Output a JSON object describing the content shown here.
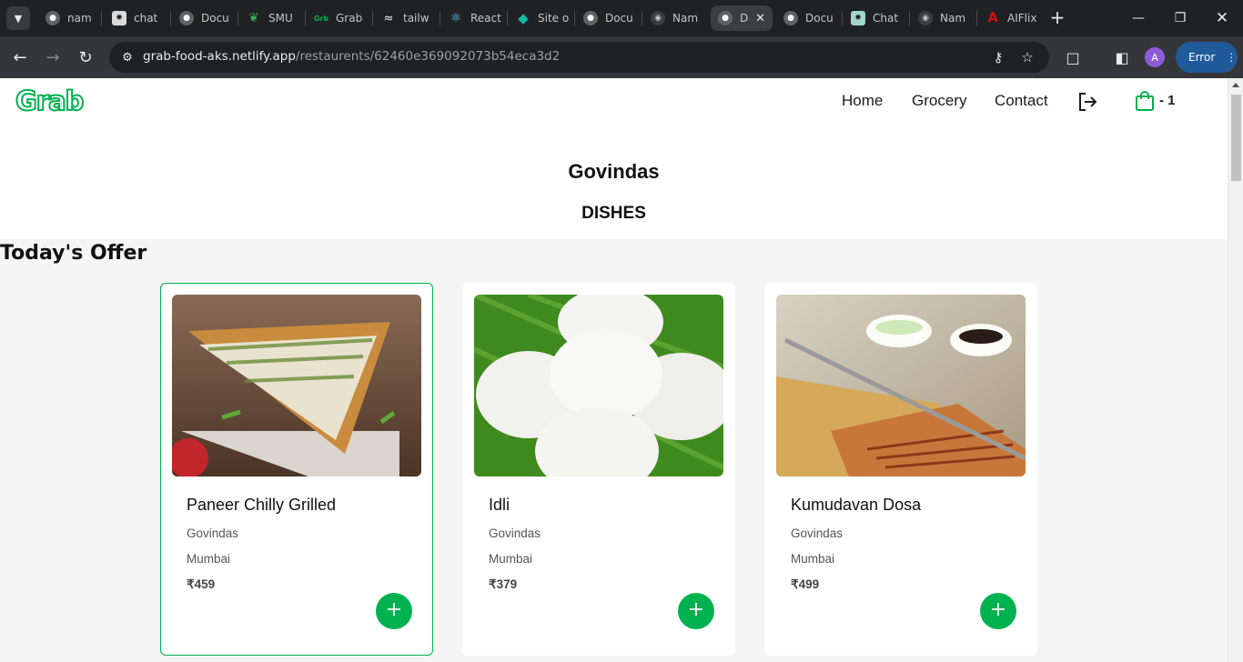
{
  "browser": {
    "tabs": [
      {
        "title": "nam",
        "icon": "generic-globe-icon"
      },
      {
        "title": "chat",
        "icon": "openai-icon"
      },
      {
        "title": "Docu",
        "icon": "generic-globe-icon"
      },
      {
        "title": "SMU",
        "icon": "leaf-icon"
      },
      {
        "title": "Grab",
        "icon": "grab-icon"
      },
      {
        "title": "tailw",
        "icon": "tailwind-icon"
      },
      {
        "title": "React",
        "icon": "react-icon"
      },
      {
        "title": "Site o",
        "icon": "netlify-icon"
      },
      {
        "title": "Docu",
        "icon": "generic-globe-icon"
      },
      {
        "title": "Nam",
        "icon": "github-icon"
      },
      {
        "title": "D",
        "icon": "generic-globe-icon"
      },
      {
        "title": "Docu",
        "icon": "generic-globe-icon"
      },
      {
        "title": "Chat",
        "icon": "openai-icon"
      },
      {
        "title": "Nam",
        "icon": "github-icon"
      },
      {
        "title": "AIFlix",
        "icon": "aiflix-icon"
      }
    ],
    "url_host": "grab-food-aks.netlify.app",
    "url_path": "/restaurents/62460e369092073b54eca3d2",
    "profile_initial": "A",
    "error_label": "Error"
  },
  "header": {
    "logo_text": "Grab",
    "nav": {
      "home": "Home",
      "grocery": "Grocery",
      "contact": "Contact"
    },
    "cart_count": "- 1"
  },
  "restaurant": {
    "name": "Govindas",
    "section_label": "DISHES"
  },
  "offer_title": "Today's Offer",
  "dishes": [
    {
      "name": "Paneer Chilly Grilled",
      "restaurant": "Govindas",
      "city": "Mumbai",
      "price": "₹459"
    },
    {
      "name": "Idli",
      "restaurant": "Govindas",
      "city": "Mumbai",
      "price": "₹379"
    },
    {
      "name": "Kumudavan Dosa",
      "restaurant": "Govindas",
      "city": "Mumbai",
      "price": "₹499"
    }
  ],
  "colors": {
    "brand": "#00b14f",
    "chrome_dark": "#202124",
    "toolbar": "#35363a"
  }
}
